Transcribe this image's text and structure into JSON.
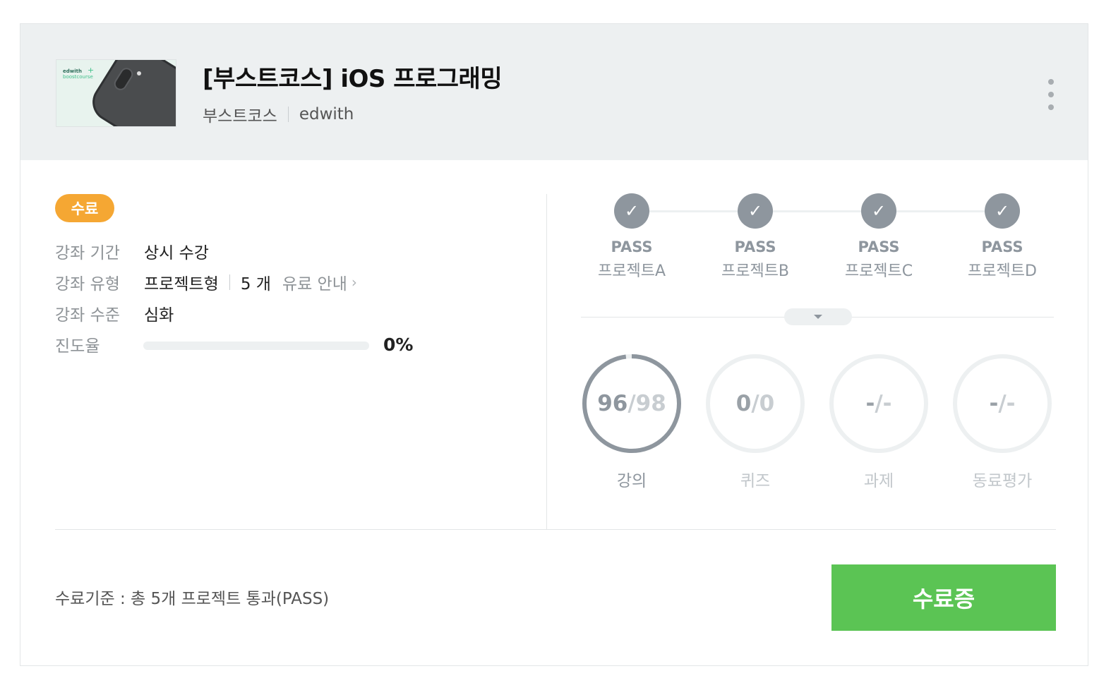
{
  "course": {
    "thumbnail_brand": "edwith",
    "thumbnail_sub": "boostcourse",
    "title": "[부스트코스] iOS 프로그래밍",
    "provider": "부스트코스",
    "platform": "edwith"
  },
  "status_badge": "수료",
  "info": {
    "period_label": "강좌 기간",
    "period_value": "상시 수강",
    "type_label": "강좌 유형",
    "type_value": "프로젝트형",
    "type_count": "5 개",
    "paid_link": "유료 안내",
    "level_label": "강좌 수준",
    "level_value": "심화",
    "progress_label": "진도율",
    "progress_value": "0%",
    "progress_fraction": 0
  },
  "steps": [
    {
      "status": "PASS",
      "name": "프로젝트A"
    },
    {
      "status": "PASS",
      "name": "프로젝트B"
    },
    {
      "status": "PASS",
      "name": "프로젝트C"
    },
    {
      "status": "PASS",
      "name": "프로젝트D"
    }
  ],
  "stats": [
    {
      "done": "96",
      "sep": "/",
      "total": "98",
      "label": "강의",
      "fraction": 0.98,
      "active": true
    },
    {
      "done": "0",
      "sep": "/",
      "total": "0",
      "label": "퀴즈",
      "fraction": 0,
      "active": false
    },
    {
      "done": "-",
      "sep": "/",
      "total": "-",
      "label": "과제",
      "fraction": 0,
      "active": false
    },
    {
      "done": "-",
      "sep": "/",
      "total": "-",
      "label": "동료평가",
      "fraction": 0,
      "active": false
    }
  ],
  "criteria": "수료기준 : 총 5개 프로젝트 통과(PASS)",
  "certificate_button": "수료증",
  "colors": {
    "header_bg": "#edf0f1",
    "badge": "#f5a733",
    "accent_green": "#5bc454",
    "gray": "#8e969e"
  }
}
